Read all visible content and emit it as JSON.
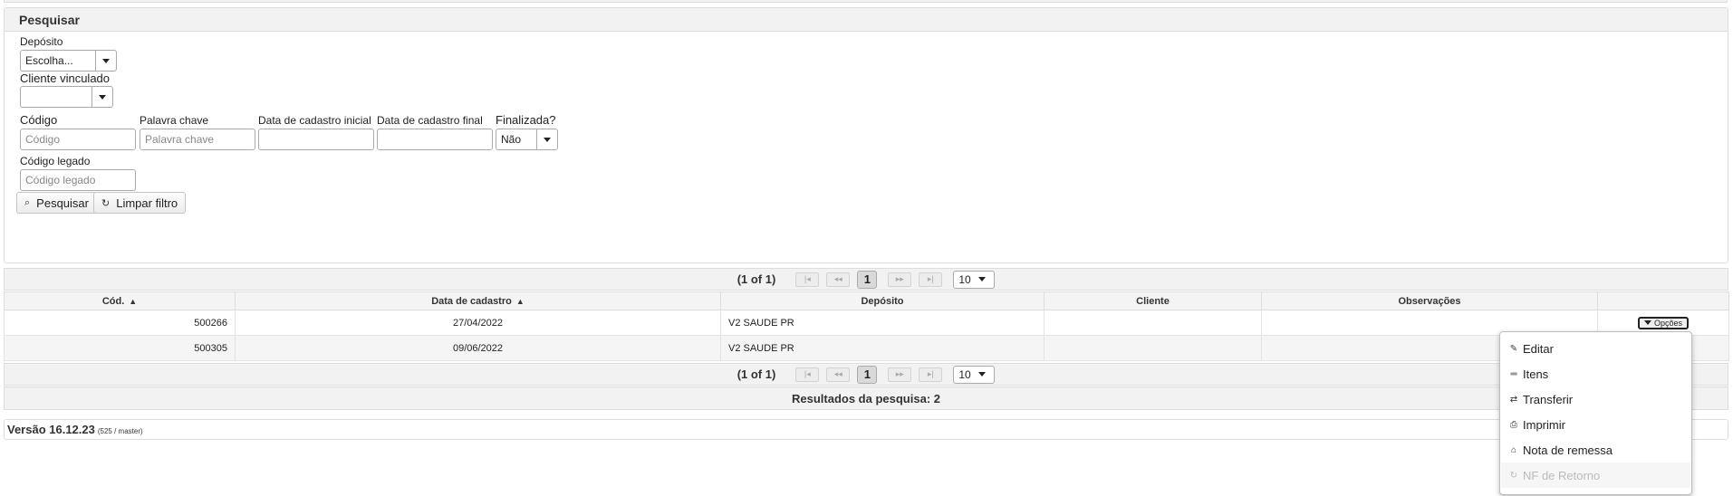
{
  "search": {
    "header": "Pesquisar",
    "deposito": {
      "label": "Depósito",
      "value": "Escolha..."
    },
    "cliente": {
      "label": "Cliente vinculado",
      "value": ""
    },
    "codigo": {
      "label": "Código",
      "placeholder": "Código"
    },
    "palavra": {
      "label": "Palavra chave",
      "placeholder": "Palavra chave"
    },
    "data_inicial": {
      "label": "Data de cadastro inicial",
      "value": ""
    },
    "data_final": {
      "label": "Data de cadastro final",
      "value": ""
    },
    "finalizada": {
      "label": "Finalizada?",
      "value": "Não"
    },
    "legado": {
      "label": "Código legado",
      "placeholder": "Código legado"
    },
    "btn_search": "Pesquisar",
    "btn_clear": "Limpar filtro"
  },
  "paginator": {
    "current": "(1 of 1)",
    "page": "1",
    "rows_per_page": "10",
    "first": "|◂",
    "prev": "◂◂",
    "next": "▸▸",
    "last": "▸|"
  },
  "table": {
    "columns": [
      "Cód.",
      "Data de cadastro",
      "Depósito",
      "Cliente",
      "Observações",
      ""
    ],
    "rows": [
      {
        "cod": "500266",
        "data": "27/04/2022",
        "deposito": "V2 SAUDE PR",
        "cliente": "",
        "obs": ""
      },
      {
        "cod": "500305",
        "data": "09/06/2022",
        "deposito": "V2 SAUDE PR",
        "cliente": "",
        "obs": ""
      }
    ],
    "options_label": "Opções"
  },
  "results": "Resultados da pesquisa: 2",
  "footer": {
    "version": "Versão 16.12.23",
    "build": "(525 / master)"
  },
  "menu": {
    "items": [
      {
        "label": "Editar",
        "icon": "pencil-icon",
        "disabled": false
      },
      {
        "label": "Itens",
        "icon": "list-icon",
        "disabled": false
      },
      {
        "label": "Transferir",
        "icon": "transfer-icon",
        "disabled": false
      },
      {
        "label": "Imprimir",
        "icon": "print-icon",
        "disabled": false
      },
      {
        "label": "Nota de remessa",
        "icon": "home-icon",
        "disabled": false
      },
      {
        "label": "NF de Retorno",
        "icon": "refresh-icon",
        "disabled": true
      }
    ]
  }
}
